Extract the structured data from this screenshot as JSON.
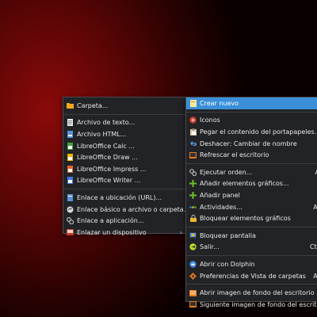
{
  "left_menu": {
    "items": [
      {
        "label": "Carpeta...",
        "icon": "folder-icon"
      },
      {
        "label": "Archivo de texto...",
        "icon": "text-file-icon"
      },
      {
        "label": "Archivo HTML...",
        "icon": "html-file-icon"
      },
      {
        "label": "LibreOffice Calc  ...",
        "icon": "calc-icon"
      },
      {
        "label": "LibreOffice Draw  ...",
        "icon": "draw-icon"
      },
      {
        "label": "LibreOffice Impress  ...",
        "icon": "impress-icon"
      },
      {
        "label": "LibreOffice Writer  ...",
        "icon": "writer-icon"
      },
      {
        "label": "Enlace a ubicación (URL)...",
        "icon": "link-url-icon"
      },
      {
        "label": "Enlace básico a archivo o carpeta...",
        "icon": "link-file-icon"
      },
      {
        "label": "Enlace a aplicación...",
        "icon": "link-app-icon"
      },
      {
        "label": "Enlazar un dispositivo",
        "icon": "device-icon",
        "submenu_arrow": "›"
      }
    ]
  },
  "right_menu": {
    "items": [
      {
        "label": "Crear nuevo",
        "icon": "create-new-icon"
      },
      {
        "label": "Iconos",
        "icon": "icons-icon"
      },
      {
        "label": "Pegar el contenido del portapapeles...",
        "icon": "paste-icon"
      },
      {
        "label": "Deshacer: Cambiar de nombre",
        "icon": "undo-icon"
      },
      {
        "label": "Refrescar el escritorio",
        "icon": "refresh-desktop-icon"
      },
      {
        "label": "Ejecutar orden...",
        "icon": "run-command-icon",
        "shortcut": "A"
      },
      {
        "label": "Añadir elementos gráficos...",
        "icon": "add-widgets-icon"
      },
      {
        "label": "Añadir panel",
        "icon": "add-panel-icon"
      },
      {
        "label": "Actividades...",
        "icon": "activities-icon",
        "shortcut": "Al"
      },
      {
        "label": "Bloquear elementos gráficos",
        "icon": "lock-widgets-icon"
      },
      {
        "label": "Bloquear pantalla",
        "icon": "lock-screen-icon"
      },
      {
        "label": "Salir...",
        "icon": "logout-icon",
        "shortcut": "Ctr"
      },
      {
        "label": "Abrir con Dolphin",
        "icon": "dolphin-icon"
      },
      {
        "label": "Preferencias de Vista de carpetas",
        "icon": "folder-view-settings-icon",
        "shortcut": "Al"
      },
      {
        "label": "Abrir imagen de fondo del escritorio",
        "icon": "open-wallpaper-icon"
      },
      {
        "label": "Siguiente imagen de fondo del escritorio",
        "icon": "next-wallpaper-icon"
      }
    ]
  },
  "colors": {
    "menu_bg": "#222326",
    "highlight": "#3a8fd8"
  }
}
